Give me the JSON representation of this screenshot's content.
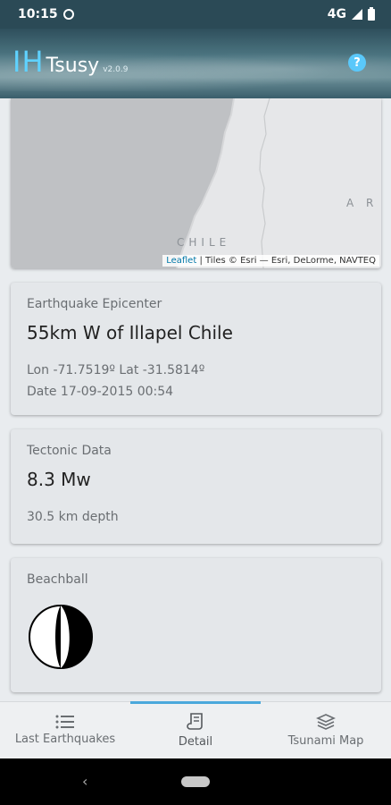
{
  "status_bar": {
    "time": "10:15",
    "network": "4G"
  },
  "app_bar": {
    "logo_ih": "IH",
    "app_name": "Tsusy",
    "version": "v2.0.9",
    "help_symbol": "?"
  },
  "map": {
    "label_chile": "CHILE",
    "label_argentina": "A R",
    "attribution_link": "Leaflet",
    "attribution_text": " | Tiles © Esri — Esri, DeLorme, NAVTEQ"
  },
  "epicenter": {
    "label": "Earthquake Epicenter",
    "title": "55km W of Illapel Chile",
    "coords": "Lon -71.7519º Lat -31.5814º",
    "date": "Date 17-09-2015 00:54"
  },
  "tectonic": {
    "label": "Tectonic Data",
    "magnitude": "8.3 Mw",
    "depth": "30.5 km depth"
  },
  "beachball": {
    "label": "Beachball"
  },
  "bottom_nav": {
    "items": [
      {
        "label": "Last Earthquakes",
        "icon": "list-icon"
      },
      {
        "label": "Detail",
        "icon": "scroll-icon"
      },
      {
        "label": "Tsunami Map",
        "icon": "layers-icon"
      }
    ],
    "active_index": 1
  },
  "colors": {
    "accent": "#4aa8dc",
    "logo_ih": "#5fd2ff",
    "help": "#5ac8fa"
  }
}
